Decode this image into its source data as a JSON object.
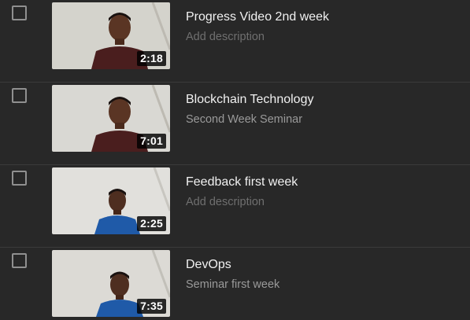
{
  "videos": [
    {
      "title": "Progress Video 2nd week",
      "description": "Add description",
      "description_is_placeholder": true,
      "duration": "2:18",
      "shirt_color": "#4a1e1e",
      "checked": false
    },
    {
      "title": "Blockchain Technology",
      "description": "Second Week Seminar",
      "description_is_placeholder": false,
      "duration": "7:01",
      "shirt_color": "#4a1e1e",
      "checked": false
    },
    {
      "title": "Feedback first week",
      "description": "Add description",
      "description_is_placeholder": true,
      "duration": "2:25",
      "shirt_color": "#1f5aa8",
      "checked": false
    },
    {
      "title": "DevOps",
      "description": "Seminar first week",
      "description_is_placeholder": false,
      "duration": "7:35",
      "shirt_color": "#1f5aa8",
      "checked": false
    }
  ],
  "colors": {
    "background": "#282828",
    "title_text": "#f1f1f1",
    "placeholder_text": "#6f6f6f",
    "description_text": "#9a9a9a"
  }
}
